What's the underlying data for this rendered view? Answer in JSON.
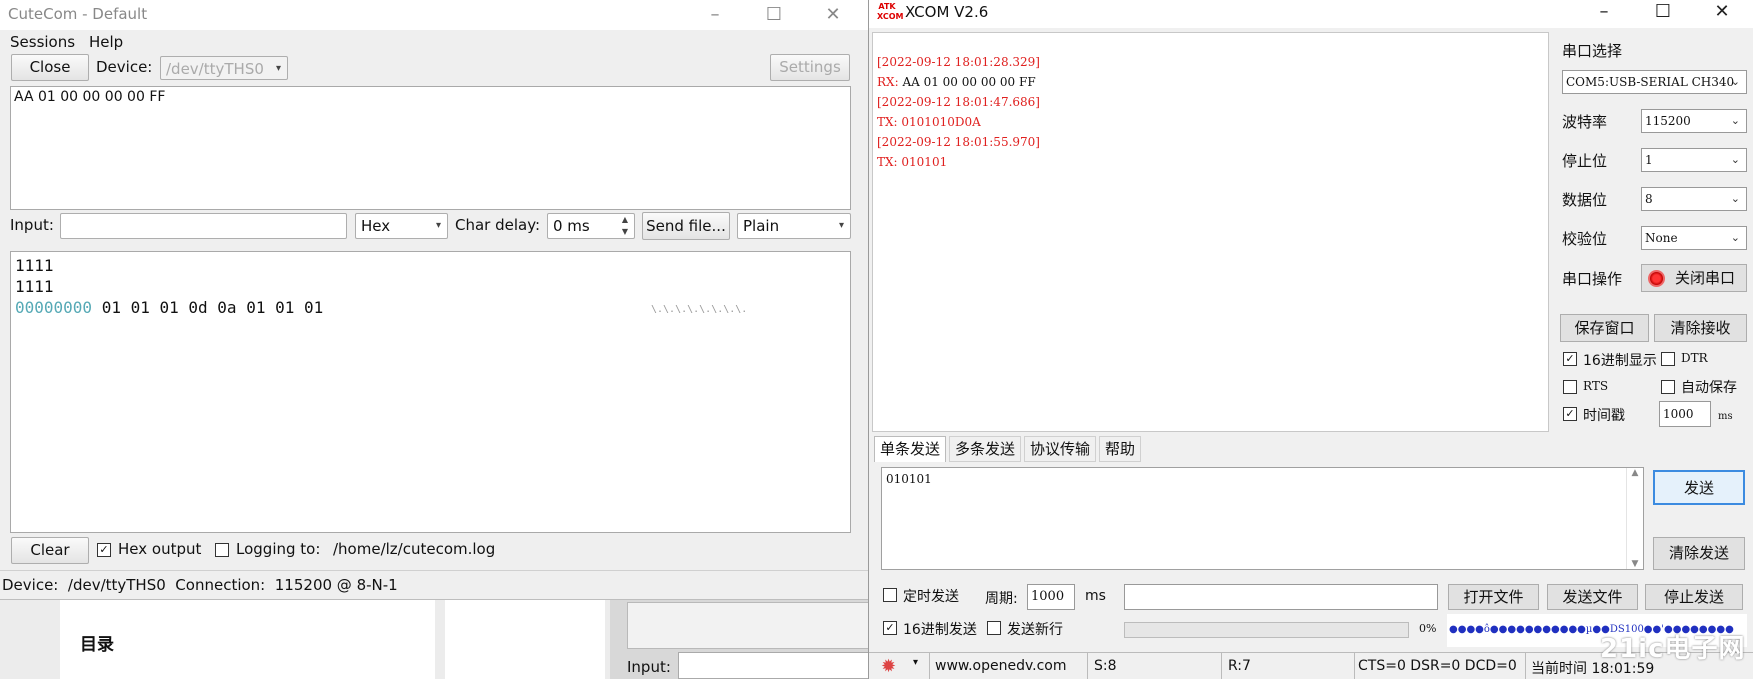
{
  "background": {
    "section_title": "目录",
    "input_label": "Input:"
  },
  "cutecom": {
    "title": "CuteCom - Default",
    "menu": [
      "Sessions",
      "Help"
    ],
    "close_button": "Close",
    "device_label": "Device:",
    "device_value": "/dev/ttyTHS0",
    "settings_button": "Settings",
    "output_text": "AA 01 00 00 00 00 FF",
    "input_label": "Input:",
    "format_value": "Hex",
    "char_delay_label": "Char delay:",
    "char_delay_value": "0 ms",
    "send_file_button": "Send file...",
    "mode_value": "Plain",
    "log_lines": [
      "1111",
      "1111"
    ],
    "hex_offset": "00000000",
    "hex_bytes": "01 01 01 0d 0a 01 01 01",
    "hex_ascii": "\\.\\.\\.\\.\\.\\.\\.\\.",
    "clear_button": "Clear",
    "hex_output_label": "Hex output",
    "logging_label": "Logging to:",
    "logging_path": "/home/lz/cutecom.log",
    "status": "Device:  /dev/ttyTHS0  Connection:  115200 @ 8-N-1"
  },
  "xcom": {
    "title": "XCOM V2.6",
    "logo_text": "ATK XCOM",
    "receive_lines": [
      {
        "prefix": "[2022-09-12 18:01:28.329]",
        "value": ""
      },
      {
        "prefix": "RX: ",
        "value": "AA 01 00 00 00 00 FF"
      },
      {
        "prefix": "[2022-09-12 18:01:47.686]",
        "value": ""
      },
      {
        "prefix": "TX: ",
        "value": "0101010D0A"
      },
      {
        "prefix": "[2022-09-12 18:01:55.970]",
        "value": ""
      },
      {
        "prefix": "TX: ",
        "value": "010101"
      }
    ],
    "port_select_label": "串口选择",
    "port_value": "COM5:USB-SERIAL CH340",
    "baud_label": "波特率",
    "baud_value": "115200",
    "stop_label": "停止位",
    "stop_value": "1",
    "data_label": "数据位",
    "data_value": "8",
    "parity_label": "校验位",
    "parity_value": "None",
    "port_op_label": "串口操作",
    "close_port_button": "关闭串口",
    "save_window_button": "保存窗口",
    "clear_receive_button": "清除接收",
    "hex_display_label": "16进制显示",
    "dtr_label": "DTR",
    "rts_label": "RTS",
    "auto_save_label": "自动保存",
    "timestamp_label": "时间戳",
    "timestamp_value": "1000",
    "timestamp_unit": "ms",
    "tabs": [
      "单条发送",
      "多条发送",
      "协议传输",
      "帮助"
    ],
    "send_text": "010101",
    "send_button": "发送",
    "clear_send_button": "清除发送",
    "timed_send_label": "定时发送",
    "period_label": "周期:",
    "period_value": "1000",
    "period_unit": "ms",
    "open_file_button": "打开文件",
    "send_file_button": "发送文件",
    "stop_send_button": "停止发送",
    "hex_send_label": "16进制发送",
    "send_newline_label": "发送新行",
    "progress_percent": 0,
    "progress_text": "0%",
    "banner_text": "●●●●ô●●●●●●●●●●●µ●●DS100●●'●●●●●●●●",
    "status": {
      "website": "www.openedv.com",
      "sent": "S:8",
      "received": "R:7",
      "signals": "CTS=0 DSR=0 DCD=0",
      "time": "当前时间 18:01:59"
    }
  },
  "watermark": "21ic电子网",
  "colors": {
    "rx_timestamp": "#e0201f",
    "hex_offset": "#55a9b5",
    "cutecom_bg": "#efefef",
    "xcom_bg": "#f0f0f0"
  }
}
